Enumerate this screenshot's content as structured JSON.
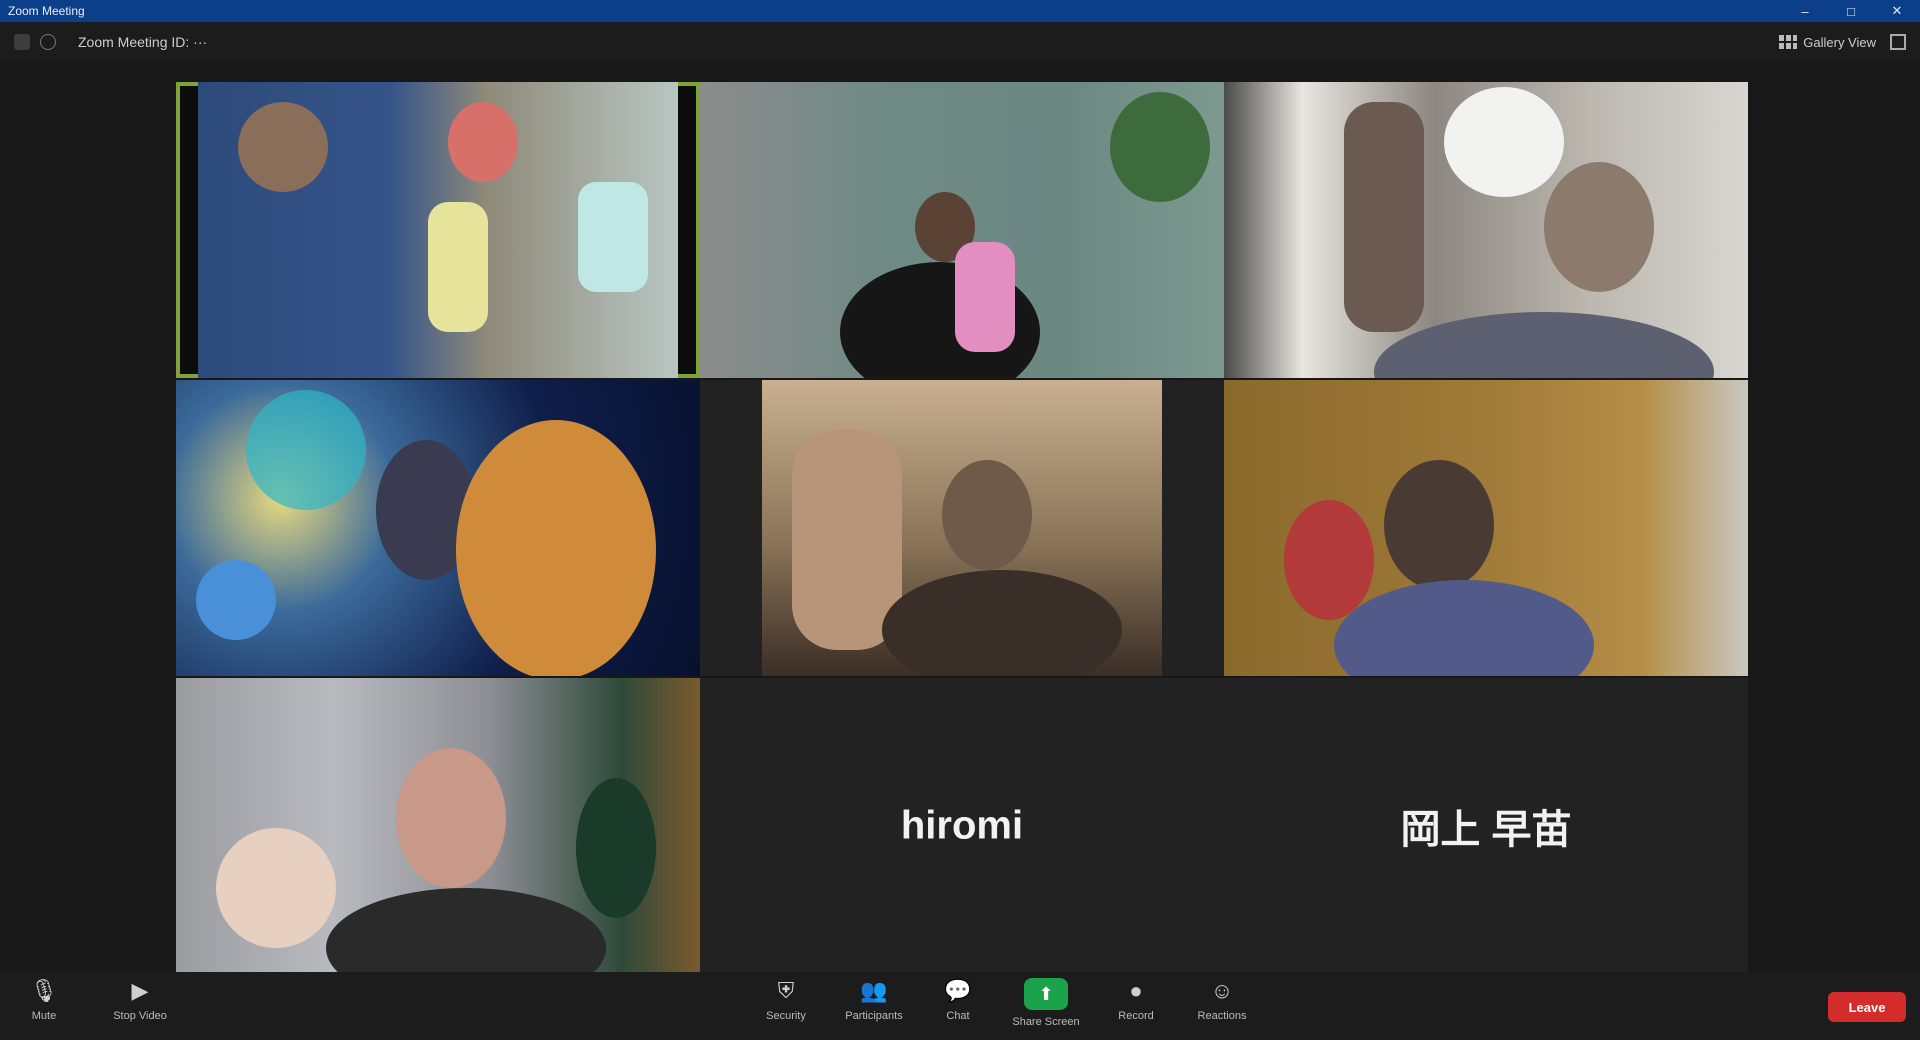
{
  "window": {
    "title": "Zoom Meeting",
    "minimize": "–",
    "maximize": "□",
    "close": "✕"
  },
  "topbar": {
    "meeting_title": "Zoom Meeting ID: ···",
    "view_label": "Gallery View"
  },
  "participants": [
    {
      "name": "",
      "active": true
    },
    {
      "name": ""
    },
    {
      "name": ""
    },
    {
      "name": ""
    },
    {
      "name": ""
    },
    {
      "name": ""
    },
    {
      "name": ""
    },
    {
      "name": "hiromi",
      "video_off": true
    },
    {
      "name": "岡上 早苗",
      "video_off": true
    }
  ],
  "toolbar": {
    "mute": "Mute",
    "video": "Stop Video",
    "security": "Security",
    "participants": "Participants",
    "chat": "Chat",
    "share": "Share Screen",
    "record": "Record",
    "reactions": "Reactions",
    "leave": "Leave"
  },
  "icons": {
    "mic": "mic-icon",
    "video": "video-camera-icon",
    "security": "shield-icon",
    "participants": "people-icon",
    "chat": "chat-bubble-icon",
    "share": "share-arrow-icon",
    "record": "record-icon",
    "reactions": "smiley-icon"
  },
  "colors": {
    "active_speaker": "#7fa33b",
    "share_button": "#1aa34a",
    "leave_button": "#d42b2b",
    "titlebar": "#0c3f8a"
  }
}
